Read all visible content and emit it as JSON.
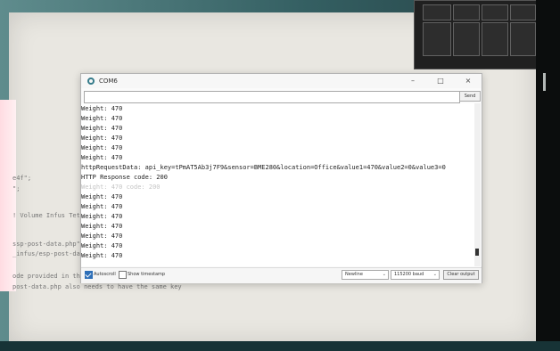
{
  "window": {
    "title": "COM6",
    "minimize": "–",
    "maximize": "□",
    "close": "×"
  },
  "send": {
    "value": "",
    "label": "Send"
  },
  "console": {
    "lines": [
      "Weight: 470",
      "Weight: 470",
      "Weight: 470",
      "Weight: 470",
      "Weight: 470",
      "Weight: 470",
      "httpRequestData: api_key=tPmAT5Ab3j7F9&sensor=BME280&location=Office&value1=470&value2=0&value3=0",
      "HTTP Response code: 200",
      "Weight: 470",
      "Weight: 470",
      "Weight: 470",
      "Weight: 470",
      "Weight: 470",
      "Weight: 470",
      "Weight: 470"
    ],
    "ghost_lines": [
      "Weight: 470     code: 200"
    ]
  },
  "footer": {
    "autoscroll": "Autoscroll",
    "timestamp": "Show timestamp",
    "line_ending": "Newline",
    "baud": "115200 baud",
    "clear": "Clear output",
    "autoscroll_checked": true,
    "timestamp_checked": false
  },
  "background_code": [
    "e4f\";",
    "\";",
    "! Volume Infus Tet",
    "ssp-post-data.php\";",
    "_infus/esp-post-dat",
    "ode provided in th",
    "post-data.php also needs to have the same key"
  ],
  "colors": {
    "accent": "#2e6fb8",
    "window_bg": "#fbfbfb",
    "desktop": "#e9e7e1"
  }
}
